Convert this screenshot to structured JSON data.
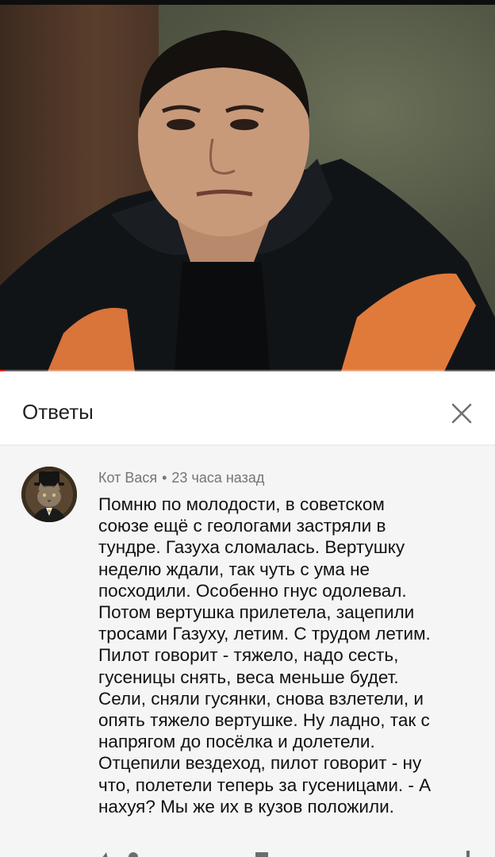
{
  "panel": {
    "title": "Ответы",
    "close_icon": "close-icon"
  },
  "video": {
    "progress_fraction": 0.01,
    "progress_color": "#e62117"
  },
  "comment": {
    "author": "Кот Вася",
    "separator": "•",
    "time": "23 часа назад",
    "avatar_icon": "cat-avatar",
    "text": "Помню по молодости, в советском\nсоюзе ещё с геологами застряли в\nтундре. Газуха сломалась.  Вертушку\nнеделю ждали, так чуть с ума не\nпосходили. Особенно гнус одолевал.\n  Потом вертушка прилетела,  зацепили\nтросами Газуху,  летим.  С трудом летим.\nПилот говорит - тяжело,  надо сесть,\nгусеницы снять, веса меньше будет.\nСели, сняли гусянки,  снова взлетели, и\nопять тяжело вертушке. Ну ладно,  так с\nнапрягом до посёлка и долетели.\n    Отцепили вездеход, пилот говорит - ну\nчто, полетели теперь за гусеницами.  - А\nнахуя?  Мы же их в кузов положили."
  },
  "icons": [
    "like-icon",
    "dislike-icon",
    "more-icon"
  ]
}
